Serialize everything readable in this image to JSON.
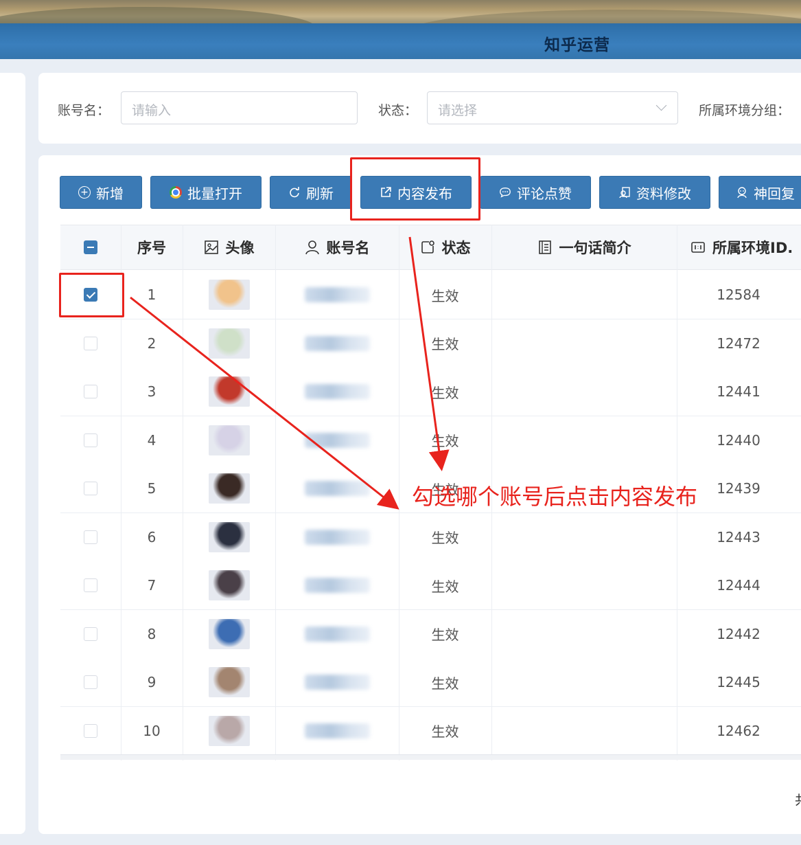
{
  "app": {
    "title": "知乎运营"
  },
  "filters": {
    "account_label": "账号名：",
    "account_placeholder": "请输入",
    "status_label": "状态：",
    "status_placeholder": "请选择",
    "env_group_label": "所属环境分组："
  },
  "toolbar": {
    "buttons": [
      {
        "label": "新增",
        "icon": "plus-circle-icon"
      },
      {
        "label": "批量打开",
        "icon": "chrome-icon"
      },
      {
        "label": "刷新",
        "icon": "refresh-icon"
      },
      {
        "label": "内容发布",
        "icon": "external-link-icon"
      },
      {
        "label": "评论点赞",
        "icon": "comment-icon"
      },
      {
        "label": "资料修改",
        "icon": "profile-edit-icon"
      },
      {
        "label": "神回复",
        "icon": "bot-icon"
      }
    ]
  },
  "table": {
    "columns": [
      "序号",
      "头像",
      "账号名",
      "状态",
      "一句话简介",
      "所属环境ID."
    ],
    "rows": [
      {
        "index": "1",
        "status": "生效",
        "intro": "",
        "env_id": "12584",
        "checked": true,
        "avatar_color": "#f1c38b"
      },
      {
        "index": "2",
        "status": "生效",
        "intro": "",
        "env_id": "12472",
        "checked": false,
        "avatar_color": "#cfe0c8"
      },
      {
        "index": "3",
        "status": "生效",
        "intro": "",
        "env_id": "12441",
        "checked": false,
        "avatar_color": "#c2392b"
      },
      {
        "index": "4",
        "status": "生效",
        "intro": "",
        "env_id": "12440",
        "checked": false,
        "avatar_color": "#d6d2e6"
      },
      {
        "index": "5",
        "status": "生效",
        "intro": "",
        "env_id": "12439",
        "checked": false,
        "avatar_color": "#3a2a25"
      },
      {
        "index": "6",
        "status": "生效",
        "intro": "",
        "env_id": "12443",
        "checked": false,
        "avatar_color": "#2b3040"
      },
      {
        "index": "7",
        "status": "生效",
        "intro": "",
        "env_id": "12444",
        "checked": false,
        "avatar_color": "#4a4048"
      },
      {
        "index": "8",
        "status": "生效",
        "intro": "",
        "env_id": "12442",
        "checked": false,
        "avatar_color": "#3d6db3"
      },
      {
        "index": "9",
        "status": "生效",
        "intro": "",
        "env_id": "12445",
        "checked": false,
        "avatar_color": "#a38570"
      },
      {
        "index": "10",
        "status": "生效",
        "intro": "",
        "env_id": "12462",
        "checked": false,
        "avatar_color": "#b9a8a8"
      }
    ]
  },
  "annotation": {
    "text": "勾选哪个账号后点击内容发布",
    "color": "#e8231d"
  },
  "footer": {
    "total_prefix": "共"
  }
}
